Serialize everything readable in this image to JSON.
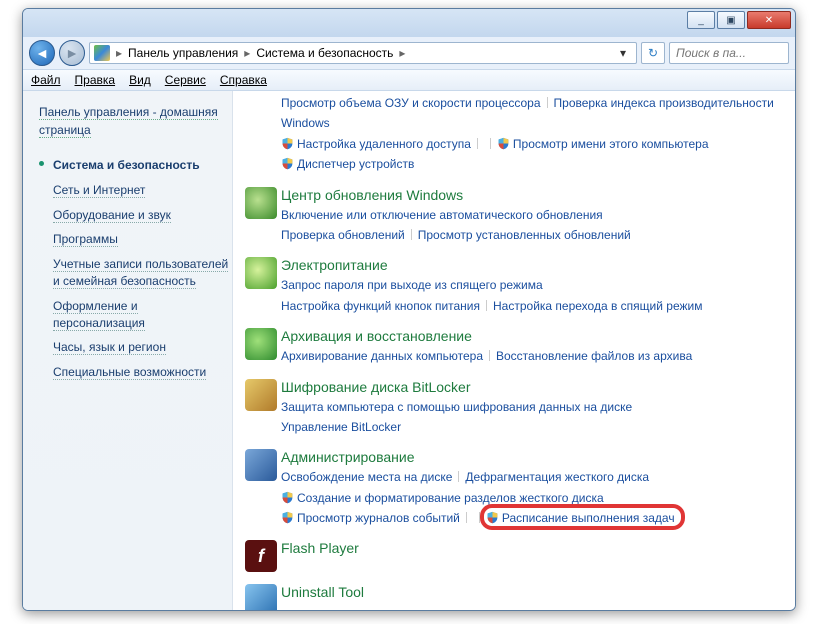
{
  "titlebar": {
    "min": "_",
    "max": "▣",
    "close": "✕"
  },
  "nav": {
    "crumb1": "Панель управления",
    "crumb2": "Система и безопасность",
    "search_placeholder": "Поиск в па..."
  },
  "menu": {
    "file": "Файл",
    "edit": "Правка",
    "view": "Вид",
    "tools": "Сервис",
    "help": "Справка"
  },
  "sidebar": {
    "home": "Панель управления - домашняя страница",
    "items": [
      "Система и безопасность",
      "Сеть и Интернет",
      "Оборудование и звук",
      "Программы",
      "Учетные записи пользователей и семейная безопасность",
      "Оформление и персонализация",
      "Часы, язык и регион",
      "Специальные возможности"
    ],
    "active_index": 0
  },
  "top_links": [
    "Просмотр объема ОЗУ и скорости процессора",
    "Проверка индекса производительности Windows",
    "Настройка удаленного доступа",
    "Просмотр имени этого компьютера",
    "Диспетчер устройств"
  ],
  "groups": [
    {
      "icon": "update",
      "title": "Центр обновления Windows",
      "links": [
        {
          "t": "Включение или отключение автоматического обновления"
        },
        {
          "t": "Проверка обновлений"
        },
        {
          "t": "Просмотр установленных обновлений"
        }
      ]
    },
    {
      "icon": "power",
      "title": "Электропитание",
      "links": [
        {
          "t": "Запрос пароля при выходе из спящего режима"
        },
        {
          "t": "Настройка функций кнопок питания"
        },
        {
          "t": "Настройка перехода в спящий режим"
        }
      ]
    },
    {
      "icon": "backup",
      "title": "Архивация и восстановление",
      "links": [
        {
          "t": "Архивирование данных компьютера"
        },
        {
          "t": "Восстановление файлов из архива"
        }
      ]
    },
    {
      "icon": "bitlocker",
      "title": "Шифрование диска BitLocker",
      "links": [
        {
          "t": "Защита компьютера с помощью шифрования данных на диске"
        },
        {
          "t": "Управление BitLocker"
        }
      ]
    },
    {
      "icon": "admin",
      "title": "Администрирование",
      "links": [
        {
          "t": "Освобождение места на диске"
        },
        {
          "t": "Дефрагментация жесткого диска"
        },
        {
          "t": "Создание и форматирование разделов жесткого диска",
          "shield": true
        },
        {
          "t": "Просмотр журналов событий",
          "shield": true
        },
        {
          "t": "Расписание выполнения задач",
          "shield": true,
          "highlight": true
        }
      ]
    },
    {
      "icon": "flash",
      "title": "Flash Player",
      "links": []
    },
    {
      "icon": "uninstall",
      "title": "Uninstall Tool",
      "links": []
    }
  ]
}
